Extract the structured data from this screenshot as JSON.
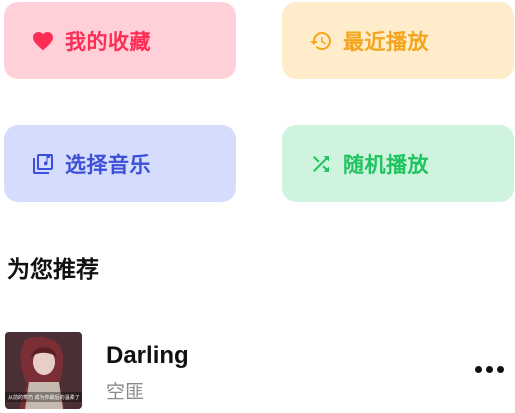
{
  "quick_actions": [
    {
      "label": "我的收藏",
      "icon": "heart-icon",
      "color": "#ff2d55",
      "bg": "#ffd0d8"
    },
    {
      "label": "最近播放",
      "icon": "history-icon",
      "color": "#f4a51c",
      "bg": "#ffeccb"
    },
    {
      "label": "选择音乐",
      "icon": "music-library-icon",
      "color": "#3b4fd8",
      "bg": "#d6dcfd"
    },
    {
      "label": "随机播放",
      "icon": "shuffle-icon",
      "color": "#1ec45f",
      "bg": "#cff3de"
    }
  ],
  "recommend": {
    "title": "为您推荐",
    "songs": [
      {
        "title": "Darling",
        "artist": "空匪",
        "cover_caption": "从前的乖巧 成为你最后的温柔了"
      }
    ]
  },
  "more_icon": "more-horizontal-icon"
}
